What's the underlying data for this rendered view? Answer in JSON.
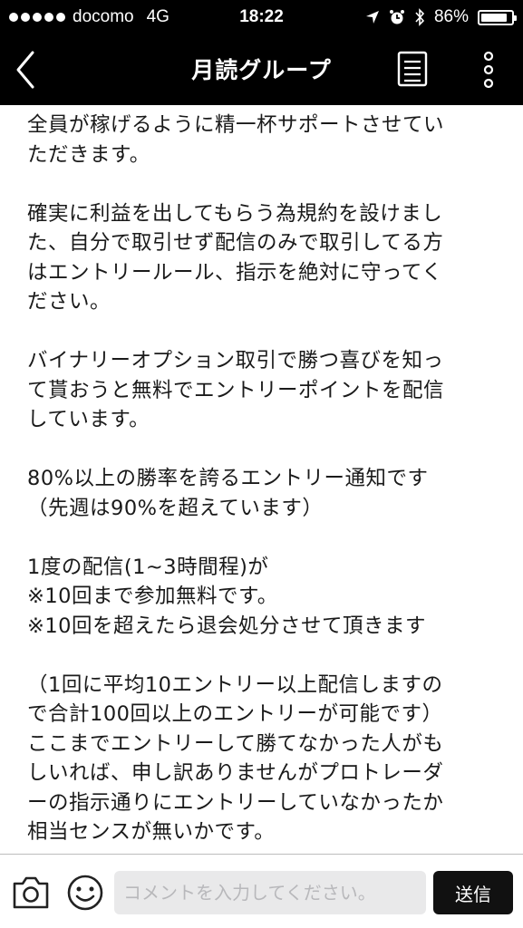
{
  "status_bar": {
    "carrier": "docomo",
    "network": "4G",
    "time": "18:22",
    "battery_percent": "86%",
    "battery_level": 0.86
  },
  "nav": {
    "title": "月読グループ",
    "back_icon": "chevron-left-icon",
    "notes_icon": "notes-icon",
    "more_icon": "more-vertical-icon"
  },
  "message": {
    "paragraphs": [
      {
        "lines": [
          "全員が稼げるように精一杯サポートさせてい",
          "ただきます。"
        ]
      },
      {
        "lines": [
          "確実に利益を出してもらう為規約を設けまし",
          "た、自分で取引せず配信のみで取引してる方",
          "はエントリールール、指示を絶対に守ってく",
          "ださい。"
        ]
      },
      {
        "lines": [
          "バイナリーオプション取引で勝つ喜びを知っ",
          "て貰おうと無料でエントリーポイントを配信",
          "しています。"
        ]
      },
      {
        "lines": [
          "80%以上の勝率を誇るエントリー通知です",
          "（先週は90%を超えています）"
        ]
      },
      {
        "lines": [
          "1度の配信(1~3時間程)が",
          "※10回まで参加無料です。",
          "※10回を超えたら退会処分させて頂きます"
        ]
      },
      {
        "lines": [
          "（1回に平均10エントリー以上配信しますの",
          "で合計100回以上のエントリーが可能です）",
          "ここまでエントリーして勝てなかった人がも",
          "しいれば、申し訳ありませんがプロトレーダ",
          "ーの指示通りにエントリーしていなかったか",
          "相当センスが無いかです。"
        ]
      }
    ]
  },
  "input_bar": {
    "placeholder": "コメントを入力してください。",
    "send_label": "送信",
    "camera_icon": "camera-icon",
    "emoji_icon": "smile-icon"
  }
}
